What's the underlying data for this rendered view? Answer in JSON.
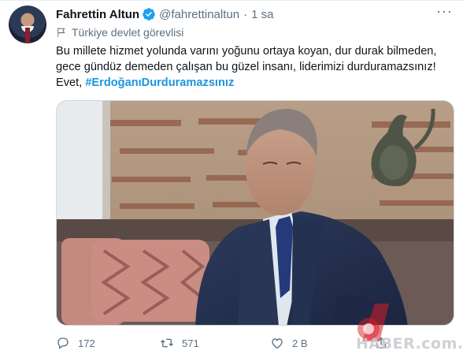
{
  "tweet": {
    "author_name": "Fahrettin Altun",
    "handle": "@fahrettinaltun",
    "separator": "·",
    "time": "1 sa",
    "account_label": "Türkiye devlet görevlisi",
    "text_line1": "Bu millete hizmet yolunda varını yoğunu ortaya koyan, dur durak bilmeden,",
    "text_line2": "gece gündüz demeden çalışan bu güzel insanı, liderimizi durduramazsınız!",
    "text_line3_prefix": "Evet, ",
    "hashtag": "#ErdoğanıDurduramazsınız",
    "more_label": "···"
  },
  "actions": {
    "replies": "172",
    "retweets": "571",
    "likes": "2 B"
  },
  "watermark": {
    "text": "HABER.com.tr"
  },
  "colors": {
    "accent": "#1b95e0",
    "verified": "#1da1f2",
    "muted": "#5b7083"
  },
  "icons": {
    "reply": "speech-bubble-icon",
    "retweet": "retweet-icon",
    "like": "heart-icon",
    "share": "share-icon",
    "verified": "verified-badge-icon",
    "label": "flag-icon"
  }
}
